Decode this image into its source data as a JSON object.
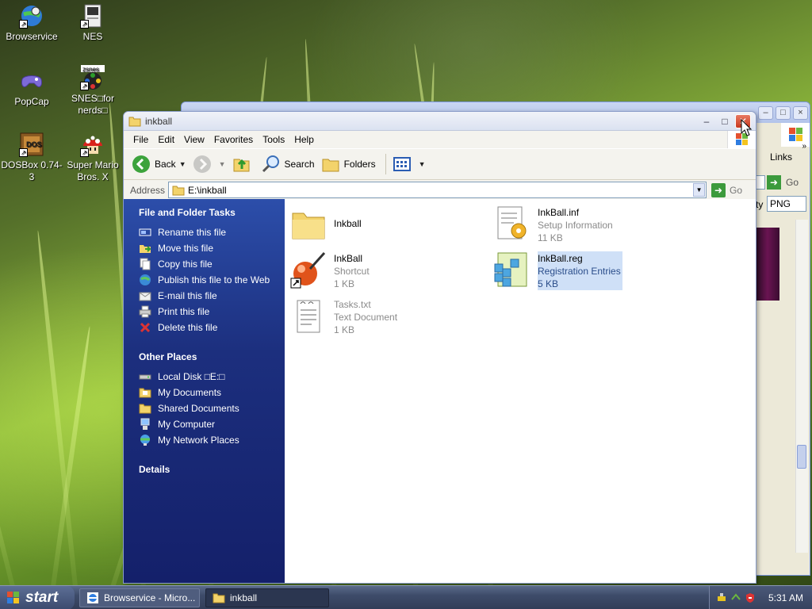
{
  "desktop": {
    "icons": [
      {
        "label": "Browservice",
        "icon": "browservice-icon"
      },
      {
        "label": "NES",
        "icon": "nes-icon"
      },
      {
        "label": "PopCap",
        "icon": "popcap-icon"
      },
      {
        "label": "SNES□for nerds□",
        "icon": "snes-icon"
      },
      {
        "label": "DOSBox 0.74-3",
        "icon": "dosbox-icon"
      },
      {
        "label": "Super Mario Bros. X",
        "icon": "mario-icon"
      }
    ]
  },
  "background_window": {
    "links_label": "Links",
    "go_label": "Go",
    "format_value": "PNG",
    "format_label": "ty"
  },
  "window": {
    "title": "inkball",
    "menu": [
      "File",
      "Edit",
      "View",
      "Favorites",
      "Tools",
      "Help"
    ],
    "toolbar": {
      "back": "Back",
      "search": "Search",
      "folders": "Folders"
    },
    "address": {
      "label": "Address",
      "value": "E:\\inkball",
      "go": "Go"
    },
    "tasks": {
      "file_folder_heading": "File and Folder Tasks",
      "file_folder_items": [
        {
          "label": "Rename this file",
          "icon": "rename-icon"
        },
        {
          "label": "Move this file",
          "icon": "move-icon"
        },
        {
          "label": "Copy this file",
          "icon": "copy-icon"
        },
        {
          "label": "Publish this file to the Web",
          "icon": "publish-icon"
        },
        {
          "label": "E-mail this file",
          "icon": "email-icon"
        },
        {
          "label": "Print this file",
          "icon": "print-icon"
        },
        {
          "label": "Delete this file",
          "icon": "delete-icon"
        }
      ],
      "other_places_heading": "Other Places",
      "other_places_items": [
        {
          "label": "Local Disk □E:□",
          "icon": "local-disk-icon"
        },
        {
          "label": "My Documents",
          "icon": "my-documents-icon"
        },
        {
          "label": "Shared Documents",
          "icon": "shared-documents-icon"
        },
        {
          "label": "My Computer",
          "icon": "my-computer-icon"
        },
        {
          "label": "My Network Places",
          "icon": "network-places-icon"
        }
      ],
      "details_heading": "Details"
    },
    "files": [
      {
        "name": "Inkball",
        "type": "",
        "size": "",
        "icon": "folder-icon"
      },
      {
        "name": "InkBall.inf",
        "type": "Setup Information",
        "size": "11 KB",
        "icon": "setup-info-icon"
      },
      {
        "name": "InkBall",
        "type": "Shortcut",
        "size": "1 KB",
        "icon": "inkball-shortcut-icon"
      },
      {
        "name": "InkBall.reg",
        "type": "Registration Entries",
        "size": "5 KB",
        "icon": "registry-icon",
        "selected": true
      },
      {
        "name": "Tasks.txt",
        "type": "Text Document",
        "size": "1 KB",
        "icon": "text-document-icon"
      }
    ]
  },
  "taskbar": {
    "start_label": "start",
    "tasks": [
      {
        "label": "Browservice - Micro...",
        "icon": "ie-icon"
      },
      {
        "label": "inkball",
        "icon": "folder-icon"
      }
    ],
    "clock": "5:31 AM"
  },
  "colors": {
    "taskpane_top": "#2c4eaa",
    "taskpane_bottom": "#14206a",
    "selection": "#cfe0f7",
    "close_button": "#c8381e"
  }
}
